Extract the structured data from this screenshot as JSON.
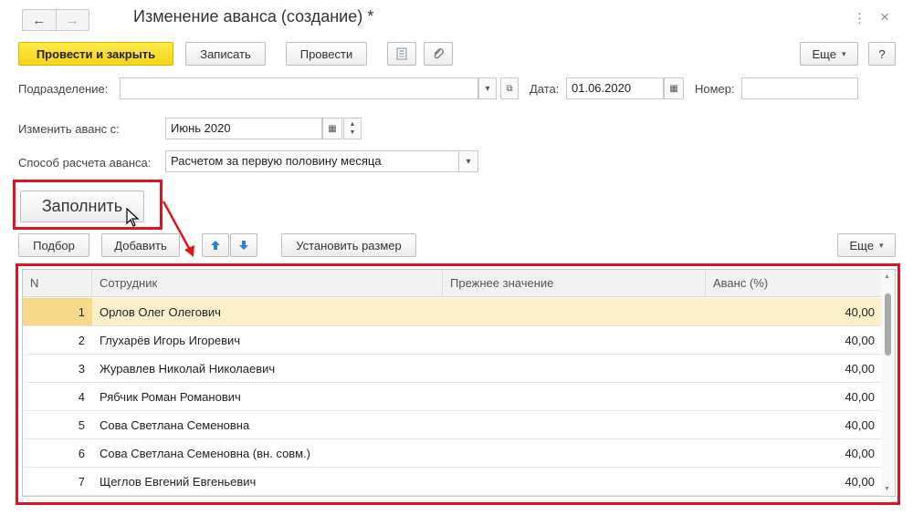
{
  "window": {
    "title": "Изменение аванса (создание) *",
    "back_icon": "←",
    "forward_icon": "→",
    "more_icon": "⋮",
    "close_icon": "×"
  },
  "toolbar": {
    "post_close": "Провести и закрыть",
    "write": "Записать",
    "post": "Провести",
    "more": "Еще",
    "help": "?"
  },
  "form": {
    "department_label": "Подразделение:",
    "department_value": "",
    "date_label": "Дата:",
    "date_value": "01.06.2020",
    "number_label": "Номер:",
    "number_value": "",
    "change_from_label": "Изменить аванс с:",
    "change_from_value": "Июнь 2020",
    "method_label": "Способ расчета аванса:",
    "method_value": "Расчетом за первую половину месяца"
  },
  "actions": {
    "fill": "Заполнить",
    "pick": "Подбор",
    "add": "Добавить",
    "set_size": "Установить размер",
    "more": "Еще"
  },
  "table": {
    "headers": [
      "N",
      "Сотрудник",
      "Прежнее значение",
      "Аванс (%)"
    ],
    "rows": [
      {
        "n": "1",
        "name": "Орлов Олег Олегович",
        "prev": "",
        "advance": "40,00"
      },
      {
        "n": "2",
        "name": "Глухарёв Игорь Игоревич",
        "prev": "",
        "advance": "40,00"
      },
      {
        "n": "3",
        "name": "Журавлев Николай Николаевич",
        "prev": "",
        "advance": "40,00"
      },
      {
        "n": "4",
        "name": "Рябчик Роман Романович",
        "prev": "",
        "advance": "40,00"
      },
      {
        "n": "5",
        "name": "Сова Светлана Семеновна",
        "prev": "",
        "advance": "40,00"
      },
      {
        "n": "6",
        "name": "Сова Светлана Семеновна (вн. совм.)",
        "prev": "",
        "advance": "40,00"
      },
      {
        "n": "7",
        "name": "Щеглов Евгений Евгеньевич",
        "prev": "",
        "advance": "40,00"
      }
    ]
  },
  "colors": {
    "primary_button": "#f5d31a",
    "selected_row": "#fbf0c9",
    "highlight": "#e0141e",
    "arrow_icons": "#2f7fd6"
  }
}
